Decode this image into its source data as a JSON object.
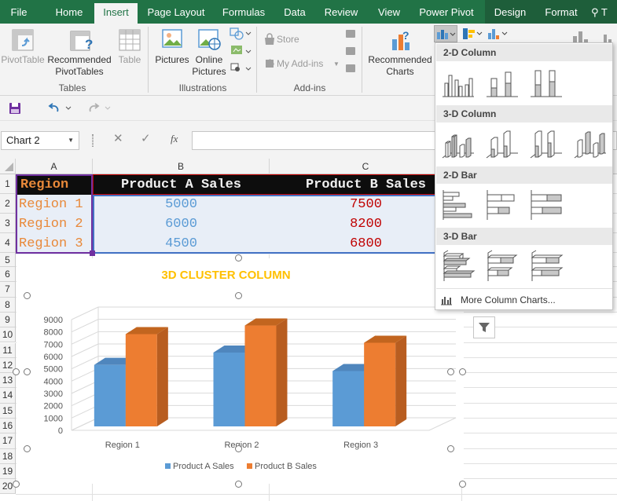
{
  "ribbon_tabs": [
    {
      "label": "File"
    },
    {
      "label": "Home"
    },
    {
      "label": "Insert"
    },
    {
      "label": "Page Layout"
    },
    {
      "label": "Formulas"
    },
    {
      "label": "Data"
    },
    {
      "label": "Review"
    },
    {
      "label": "View"
    },
    {
      "label": "Power Pivot"
    },
    {
      "label": "Design"
    },
    {
      "label": "Format"
    },
    {
      "label": "T"
    }
  ],
  "ribbon": {
    "tables": {
      "pivot": "PivotTable",
      "recommended_1": "Recommended",
      "recommended_2": "PivotTables",
      "table": "Table",
      "group": "Tables"
    },
    "illustrations": {
      "pictures": "Pictures",
      "online_1": "Online",
      "online_2": "Pictures",
      "group": "Illustrations"
    },
    "addins": {
      "store": "Store",
      "myaddins": "My Add-ins",
      "group": "Add-ins"
    },
    "charts": {
      "recommended_1": "Recommended",
      "recommended_2": "Charts"
    }
  },
  "name_box": "Chart 2",
  "fx_label": "fx",
  "columns": [
    "A",
    "B",
    "C"
  ],
  "rows": [
    "1",
    "2",
    "3",
    "4",
    "5",
    "6",
    "7",
    "8",
    "9",
    "10",
    "11",
    "12",
    "13",
    "14",
    "15",
    "16",
    "17",
    "18",
    "19",
    "20"
  ],
  "table": {
    "headers": [
      "Region",
      "Product A Sales",
      "Product B Sales"
    ],
    "data": [
      [
        "Region 1",
        "5000",
        "7500"
      ],
      [
        "Region 2",
        "6000",
        "8200"
      ],
      [
        "Region 3",
        "4500",
        "6800"
      ]
    ]
  },
  "gallery": {
    "sections": [
      "2-D Column",
      "3-D Column",
      "2-D Bar",
      "3-D Bar"
    ],
    "more": "More Column Charts..."
  },
  "colors": {
    "excel_green": "#217346",
    "header_bg": "#0d0d0d",
    "header_text": "#f0f0f0",
    "region_text": "#e8893a",
    "a_text": "#5b9bd5",
    "b_text": "#c00000",
    "series_a": "#5b9bd5",
    "series_b": "#ed7d31",
    "title": "#ffc000"
  },
  "chart_data": {
    "type": "bar",
    "title": "3D CLUSTER COLUMN",
    "categories": [
      "Region 1",
      "Region 2",
      "Region 3"
    ],
    "series": [
      {
        "name": "Product A Sales",
        "values": [
          5000,
          6000,
          4500
        ]
      },
      {
        "name": "Product B Sales",
        "values": [
          7500,
          8200,
          6800
        ]
      }
    ],
    "ylim": [
      0,
      9000
    ],
    "yticks": [
      "9000",
      "8000",
      "7000",
      "6000",
      "5000",
      "4000",
      "3000",
      "2000",
      "1000",
      "0"
    ],
    "legend": "bottom",
    "grid": true
  }
}
